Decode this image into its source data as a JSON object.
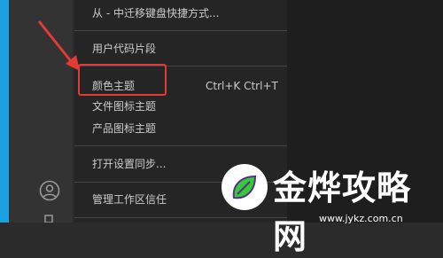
{
  "menu": {
    "items": [
      {
        "label": "从 - 中迁移键盘快捷方式..."
      },
      {
        "label": "用户代码片段"
      },
      {
        "label": "颜色主题",
        "shortcut": "Ctrl+K Ctrl+T"
      },
      {
        "label": "文件图标主题"
      },
      {
        "label": "产品图标主题"
      },
      {
        "label": "打开设置同步..."
      },
      {
        "label": "管理工作区信任"
      }
    ]
  },
  "activity_bar": {
    "icons": [
      "account-icon",
      "gear-icon"
    ]
  },
  "annotation": {
    "highlight_color": "#e53935"
  },
  "watermark": {
    "title": "金烨攻略网",
    "url": "www.jykz.com.cn"
  }
}
